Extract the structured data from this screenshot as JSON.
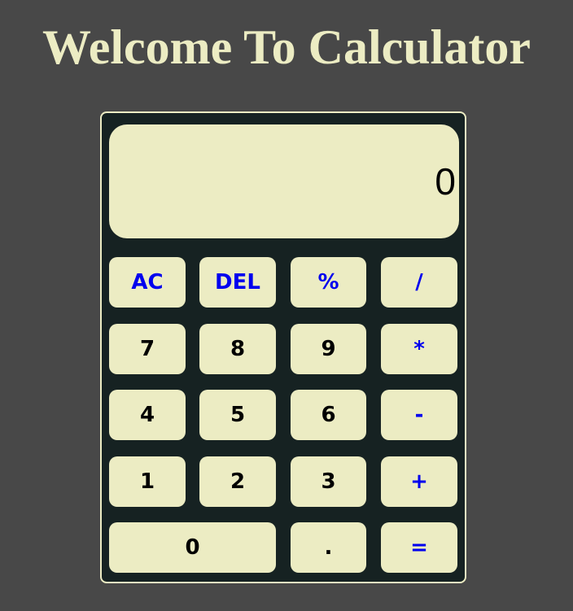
{
  "title": "Welcome To Calculator",
  "display": {
    "value": "0"
  },
  "keys": {
    "ac": "AC",
    "del": "DEL",
    "percent": "%",
    "divide": "/",
    "seven": "7",
    "eight": "8",
    "nine": "9",
    "multiply": "*",
    "four": "4",
    "five": "5",
    "six": "6",
    "minus": "-",
    "one": "1",
    "two": "2",
    "three": "3",
    "plus": "+",
    "zero": "0",
    "dot": ".",
    "equals": "="
  },
  "colors": {
    "background": "#484848",
    "panel": "#162222",
    "key": "#ececc3",
    "operator_text": "#0000ee",
    "number_text": "#000000",
    "title": "#ececc3"
  }
}
